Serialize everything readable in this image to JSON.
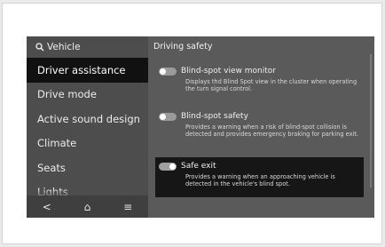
{
  "search": {
    "label": "Vehicle"
  },
  "menu": {
    "items": [
      {
        "label": "Driver assistance"
      },
      {
        "label": "Drive mode"
      },
      {
        "label": "Active sound design"
      },
      {
        "label": "Climate"
      },
      {
        "label": "Seats"
      },
      {
        "label": "Lights"
      }
    ]
  },
  "bottom_bar": {
    "back": "<",
    "home": "⌂",
    "menu": "≡"
  },
  "section": {
    "title": "Driving safety"
  },
  "settings": [
    {
      "name": "Blind-spot view monitor",
      "desc": "Displays thd Blind Spot view in the cluster when operating the turn signal control.",
      "enabled": false
    },
    {
      "name": "Blind-spot safety",
      "desc": "Provides a warning when a risk of blind-spot collision is detected and provides emergency braking for parking exit.",
      "enabled": false
    },
    {
      "name": "Safe exit",
      "desc": "Provides a warning when an approaching vehicle is detected in the vehicle's blind spot.",
      "enabled": true
    }
  ],
  "colors": {
    "highlight": "#161616",
    "active_menu": "#111111",
    "panel": "#5a5a5a"
  }
}
